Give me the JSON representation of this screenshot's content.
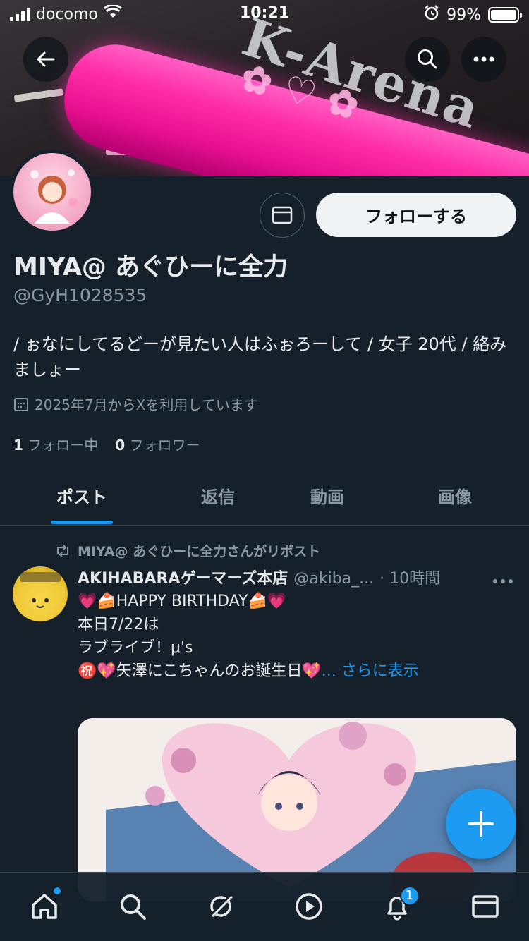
{
  "status_bar": {
    "carrier": "docomo",
    "time": "10:21",
    "battery_text": "99%"
  },
  "profile": {
    "name": "MIYA@ あぐひーに全力",
    "handle": "@GyH1028535",
    "bio": "/ ぉなにしてるどーが見たい人はふぉろーして / 女子 20代 / 絡みましょー",
    "joined": "2025年7月からXを利用しています",
    "following_count": "1",
    "following_label": "フォロー中",
    "followers_count": "0",
    "followers_label": "フォロワー",
    "follow_button": "フォローする"
  },
  "tabs": [
    {
      "label": "ポスト"
    },
    {
      "label": "返信"
    },
    {
      "label": "動画"
    },
    {
      "label": "画像"
    }
  ],
  "post": {
    "repost_label": "MIYA@ あぐひーに全力さんがリポスト",
    "author_name": "AKIHABARAゲーマーズ本店",
    "author_handle": "@akiba_...",
    "time": "· 10時間",
    "line1": "💗🍰HAPPY BIRTHDAY🍰💗",
    "line2": "本日7/22は",
    "line3": "ラブライブ！μ's",
    "line4": "㊗️💖矢澤にこちゃんのお誕生日💖",
    "more_label": "... さらに表示"
  },
  "bottom_nav": {
    "notification_count": "1"
  },
  "colors": {
    "background": "#15202b",
    "accent": "#1d9bf0",
    "secondary_text": "#8b98a5"
  }
}
